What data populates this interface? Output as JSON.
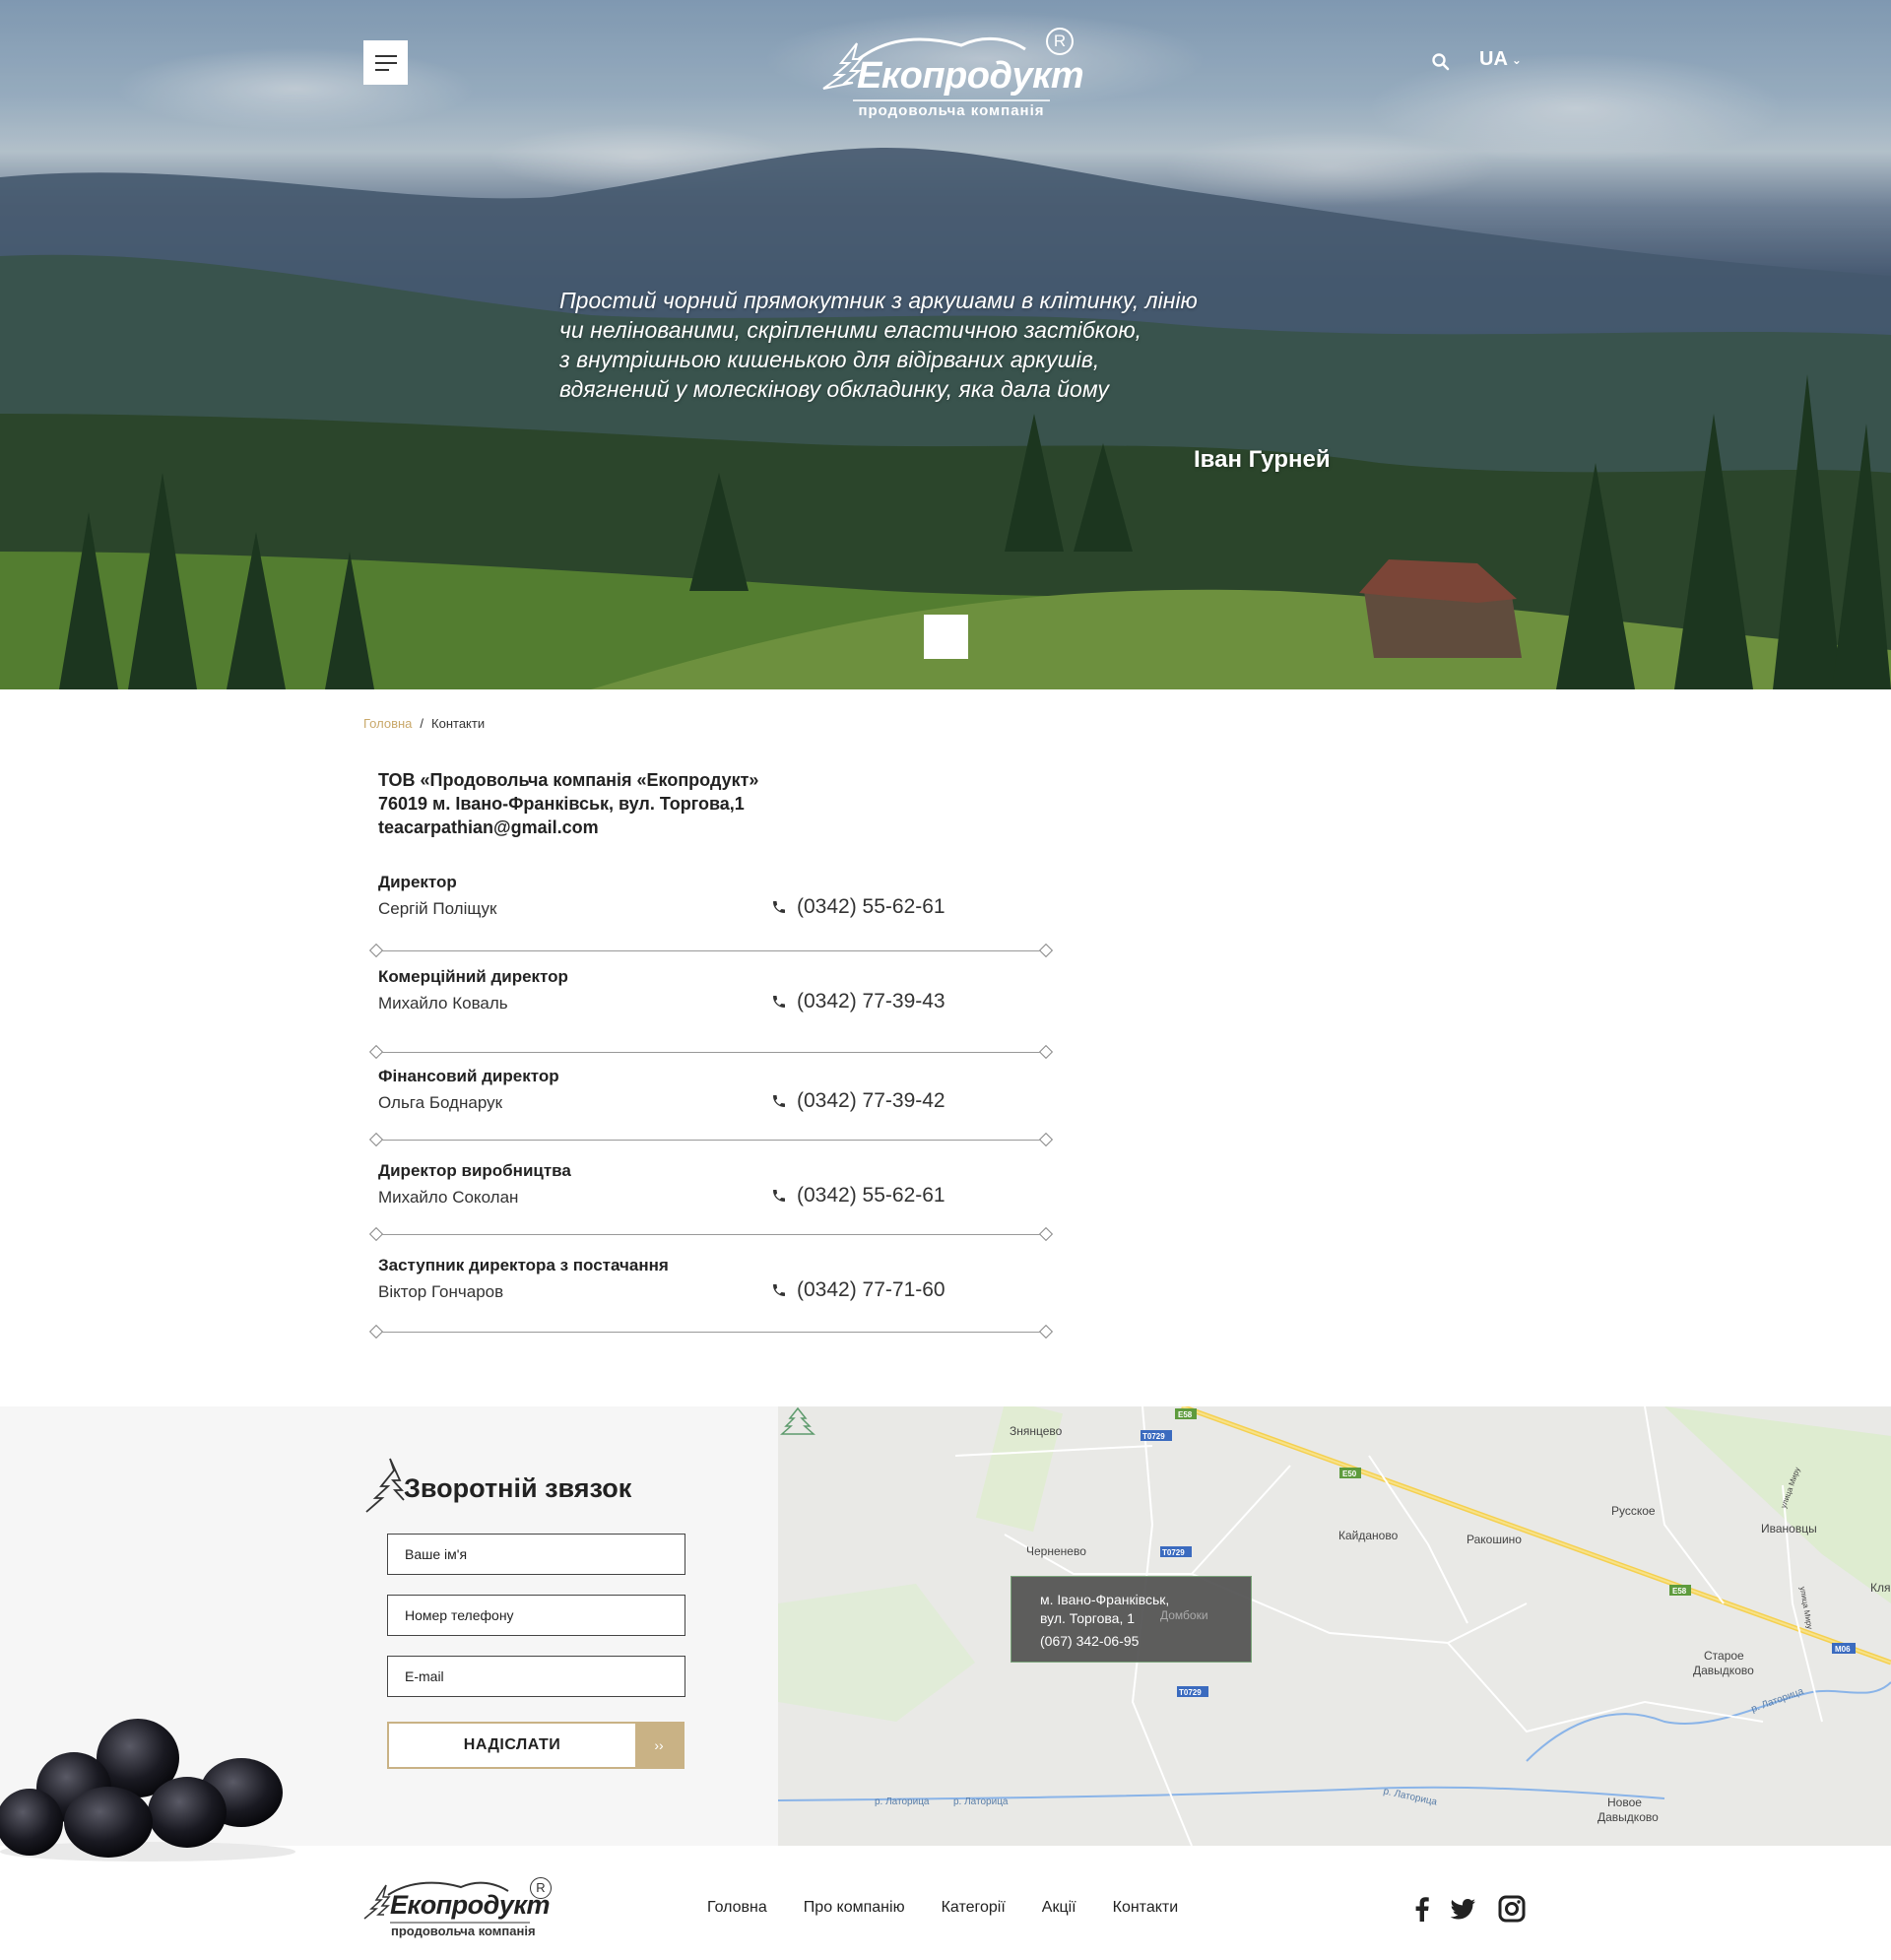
{
  "header": {
    "brand": "Екопродукт",
    "registered_mark": "R",
    "tagline": "продовольча компанія",
    "language": "UA"
  },
  "hero": {
    "quote_lines": [
      "Простий чорний прямокутник з аркушами в клітинку, лінію",
      "чи нелінованими, скріпленими еластичною застібкою,",
      "з внутрішньою кишенькою для відірваних аркушів,",
      "вдягнений у молескінову обкладинку, яка дала йому"
    ],
    "author": "Іван Гурней"
  },
  "breadcrumb": {
    "home": "Головна",
    "separator": "/",
    "current": "Контакти"
  },
  "company": {
    "name": "ТОВ «Продовольча компанія «Екопродукт»",
    "address": "76019 м. Івано-Франківськ, вул. Торгова,1",
    "email": "teacarpathian@gmail.com"
  },
  "contacts": [
    {
      "role": "Директор",
      "person": "Сергій Поліщук",
      "phone": "(0342) 55-62-61"
    },
    {
      "role": "Комерційний директор",
      "person": "Михайло Коваль",
      "phone": "(0342) 77-39-43"
    },
    {
      "role": "Фінансовий директор",
      "person": "Ольга Боднарук",
      "phone": "(0342) 77-39-42"
    },
    {
      "role": "Директор виробництва",
      "person": "Михайло Соколан",
      "phone": "(0342) 55-62-61"
    },
    {
      "role": "Заступник директора з постачання",
      "person": "Віктор Гончаров",
      "phone": "(0342) 77-71-60"
    }
  ],
  "feedback": {
    "title": "Зворотній звязок",
    "name_placeholder": "Ваше ім'я",
    "phone_placeholder": "Номер телефону",
    "email_placeholder": "E-mail",
    "submit": "НАДІСЛАТИ",
    "submit_arrow": "››"
  },
  "map": {
    "popup": {
      "line1": "м. Івано-Франківськ,",
      "line2": "вул. Торгова, 1",
      "phone": "(067) 342-06-95"
    },
    "places": [
      "Знянцево",
      "Черненево",
      "Кайданово",
      "Ракошино",
      "Русское",
      "Ивановцы",
      "Кля",
      "Домбоки",
      "Старое",
      "Давыдково",
      "Новое",
      "Давыдково",
      "р. Латорица",
      "р. Латорица",
      "р. Латорица",
      "р. Латорица",
      "улица Миру",
      "улица Миру"
    ],
    "road_badges": [
      "E58",
      "T0729",
      "E50",
      "T0729",
      "E58",
      "M06",
      "T0729"
    ]
  },
  "footer": {
    "brand": "Екопродукт",
    "registered_mark": "R",
    "tagline": "продовольча компанія",
    "nav": [
      "Головна",
      "Про компанію",
      "Категорії",
      "Акції",
      "Контакти"
    ]
  },
  "colors": {
    "accent": "#c9b285",
    "breadcrumb_link": "#c9a86a",
    "map_bg": "#e8e8e5",
    "river": "#8ab4e8",
    "highway": "#f5d04f"
  },
  "icons": [
    "menu-icon",
    "search-icon",
    "chevron-down-icon",
    "phone-icon",
    "tree-icon",
    "facebook-icon",
    "twitter-icon",
    "instagram-icon"
  ]
}
